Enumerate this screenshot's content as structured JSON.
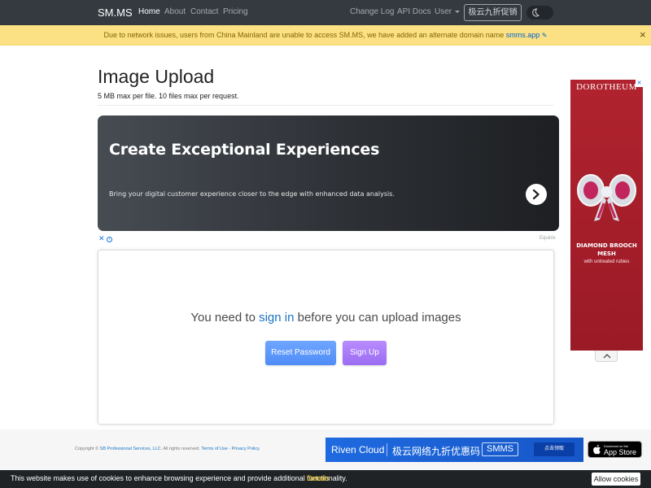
{
  "navbar": {
    "brand": "SM.MS",
    "links": [
      "Home",
      "About",
      "Contact",
      "Pricing"
    ],
    "right_links": [
      "Change Log",
      "API Docs",
      "User"
    ],
    "promo_button": "极云九折促销",
    "theme_toggle_icon": "moon-icon"
  },
  "alert": {
    "text": "Due to network issues, users from China Mainland are unable to access SM.MS, we have added an alternate domain name",
    "link": "smms.app",
    "close": "×"
  },
  "page": {
    "title": "Image Upload",
    "subtitle": "5 MB max per file. 10 files max per request."
  },
  "ad_banner": {
    "headline": "Create Exceptional Experiences",
    "body": "Bring your digital customer experience closer to the edge with enhanced data analysis.",
    "arrow_icon": "chevron-right-icon",
    "ad_choices": "✕",
    "sponsor": "Equinix"
  },
  "upload": {
    "message_before": "You need to",
    "message_link": "sign in",
    "message_after": "before you can upload images",
    "reset_button": "Reset Password",
    "signup_button": "Sign Up"
  },
  "side_ad": {
    "brand": "DOROTHEUM",
    "title": "DIAMOND BROOCH MESH",
    "tagline": "with untreated rubies",
    "collapse_icon": "chevron-up-icon"
  },
  "footer": {
    "copyright_prefix": "Copyright ©",
    "company": "SB Professional Services, LLC.",
    "rights": "All rights reserved.",
    "terms": "Terms of Use",
    "separator": "-",
    "privacy": "Privacy Policy",
    "riven_ad": {
      "name": "Riven Cloud",
      "promo": "极云网络九折优惠码",
      "code": "SMMS",
      "button": "点击领取"
    },
    "appstore": {
      "small": "Download on the",
      "big": "App Store"
    }
  },
  "cookie": {
    "text": "This website makes use of cookies to enhance browsing experience and provide additional functionality.",
    "details": "Details",
    "button": "Allow cookies"
  },
  "colors": {
    "navbar": "#343a40",
    "alert_bg": "#fbe183",
    "alert_text": "#856404",
    "link_blue": "#1a73c4",
    "reset_button": "#5b95f9",
    "signup_button": "#a77bf7",
    "side_ad_bg": "#a81f2b",
    "cookie_bar": "#202326",
    "cookie_details": "#f1c40f"
  }
}
